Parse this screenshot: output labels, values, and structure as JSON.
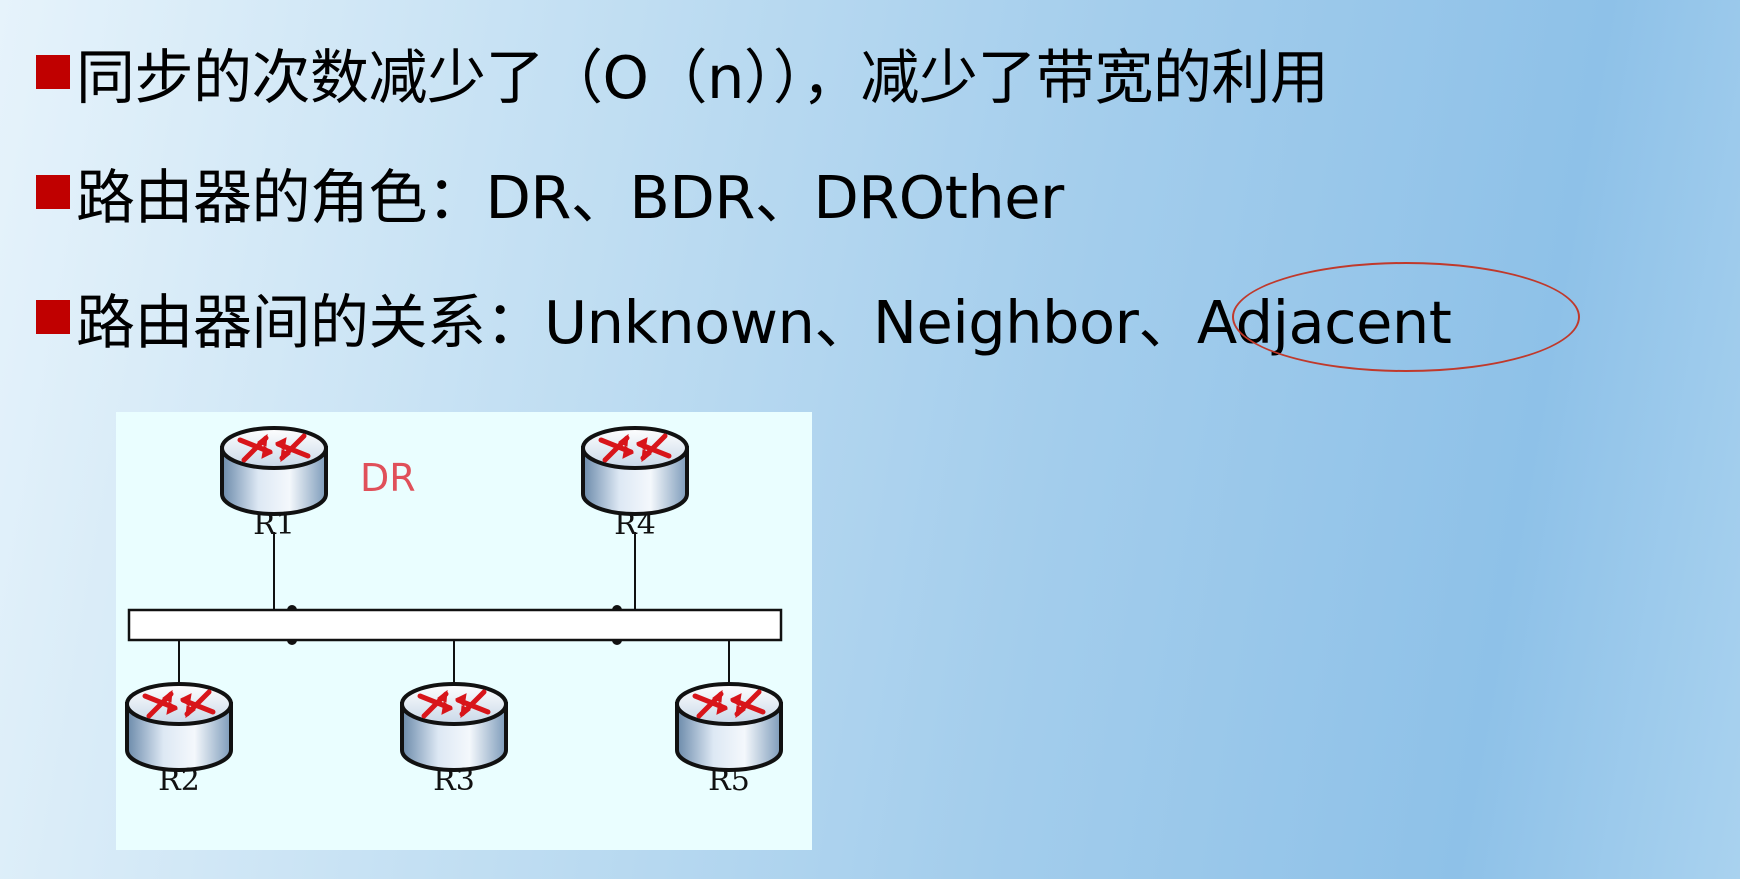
{
  "bullets": [
    {
      "text": "同步的次数减少了（O（n）），减少了带宽的利用"
    },
    {
      "text": "路由器的角色：DR、BDR、DROther"
    },
    {
      "text": "路由器间的关系：Unknown、Neighbor、Adjacent"
    }
  ],
  "diagram": {
    "dr_label": "DR",
    "routers": [
      {
        "label": "R1"
      },
      {
        "label": "R4"
      },
      {
        "label": "R2"
      },
      {
        "label": "R3"
      },
      {
        "label": "R5"
      }
    ]
  },
  "colors": {
    "bullet_marker": "#c00000",
    "highlight": "#c0392b",
    "dr_label": "#e0505a",
    "router_arrow": "#d8151a"
  }
}
